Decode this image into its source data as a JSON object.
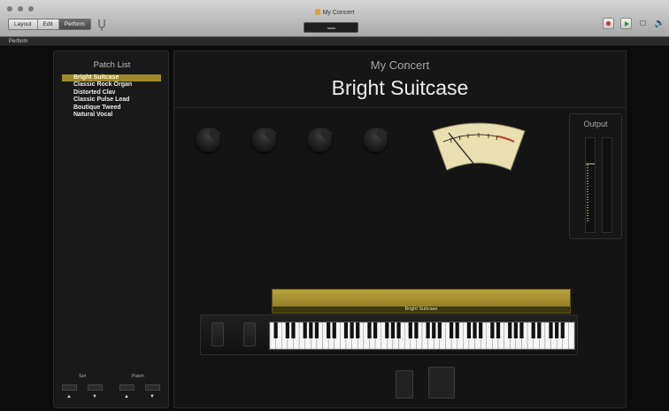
{
  "window": {
    "title": "My Concert"
  },
  "toolbar": {
    "modes": [
      "Layout",
      "Edit",
      "Perform"
    ],
    "active_mode": "Perform"
  },
  "subbar": {
    "label": "Perform"
  },
  "patch_list": {
    "title": "Patch List",
    "items": [
      "Bright Suitcase",
      "Classic Rock Organ",
      "Distorted Clav",
      "Classic Pulse Lead",
      "Boutique Tweed",
      "Natural Vocal"
    ],
    "selected": "Bright Suitcase"
  },
  "set_patch": {
    "set_label": "Set",
    "patch_label": "Patch"
  },
  "header": {
    "concert": "My Concert",
    "patch": "Bright Suitcase"
  },
  "output": {
    "title": "Output"
  },
  "assignment": {
    "label": "Bright Suitcase"
  },
  "colors": {
    "accent": "#9e8a2b",
    "vu_face": "#e9dfb1",
    "record": "#d03030"
  }
}
